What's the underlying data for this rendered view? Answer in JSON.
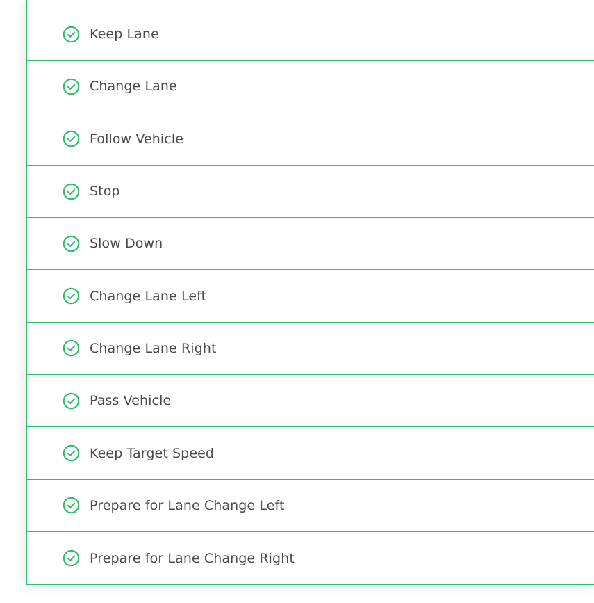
{
  "theme": {
    "accent_color": "#2ebd6b",
    "text_color": "#4a4a4a"
  },
  "items": [
    {
      "label": "Keep Lane",
      "icon": "check-circle-icon",
      "status": "completed"
    },
    {
      "label": "Change Lane",
      "icon": "check-circle-icon",
      "status": "completed"
    },
    {
      "label": "Follow Vehicle",
      "icon": "check-circle-icon",
      "status": "completed"
    },
    {
      "label": "Stop",
      "icon": "check-circle-icon",
      "status": "completed"
    },
    {
      "label": "Slow Down",
      "icon": "check-circle-icon",
      "status": "completed"
    },
    {
      "label": "Change Lane Left",
      "icon": "check-circle-icon",
      "status": "completed"
    },
    {
      "label": "Change Lane Right",
      "icon": "check-circle-icon",
      "status": "completed"
    },
    {
      "label": "Pass Vehicle",
      "icon": "check-circle-icon",
      "status": "completed"
    },
    {
      "label": "Keep Target Speed",
      "icon": "check-circle-icon",
      "status": "completed"
    },
    {
      "label": "Prepare for Lane Change Left",
      "icon": "check-circle-icon",
      "status": "completed"
    },
    {
      "label": "Prepare for Lane Change Right",
      "icon": "check-circle-icon",
      "status": "completed"
    }
  ]
}
